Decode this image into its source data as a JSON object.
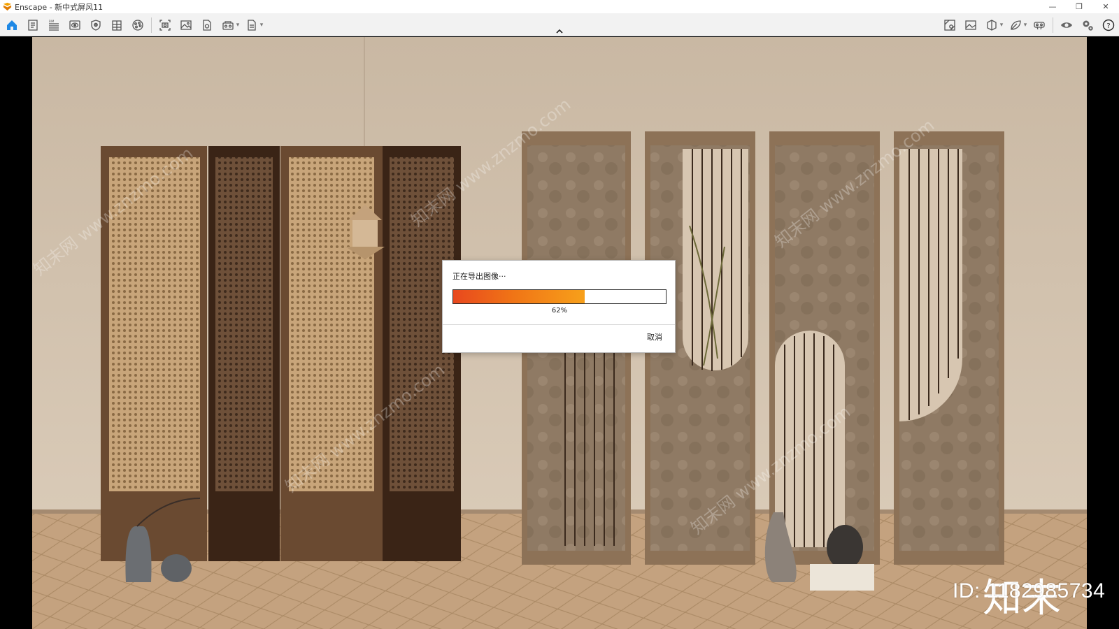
{
  "window": {
    "title": "Enscape - 新中式屏风11",
    "minimize_glyph": "—",
    "restore_glyph": "❐",
    "close_glyph": "✕"
  },
  "toolbar": {
    "left_icons": [
      "home-icon",
      "document-icon",
      "bim-list-icon",
      "eye-panel-icon",
      "shield-icon",
      "building-icon",
      "palette-icon",
      "screenshot-icon",
      "image-icon",
      "export-file-icon",
      "panorama-icon",
      "batch-render-icon"
    ],
    "right_icons": [
      "map-icon",
      "gallery-icon",
      "cube-view-icon",
      "asset-leaf-icon",
      "vr-headset-icon",
      "visibility-icon",
      "settings-icon",
      "help-icon"
    ],
    "accent_color": "#1e88e5"
  },
  "dialog": {
    "title": "正在导出图像···",
    "progress_percent": 62,
    "progress_label": "62%",
    "cancel_label": "取消",
    "progress_gradient": [
      "#e8481e",
      "#f7a01a"
    ]
  },
  "watermark": {
    "logo_text": "知末",
    "id_text": "ID: 1182985734",
    "diagonal_text": "知末网 www.znzmo.com"
  }
}
